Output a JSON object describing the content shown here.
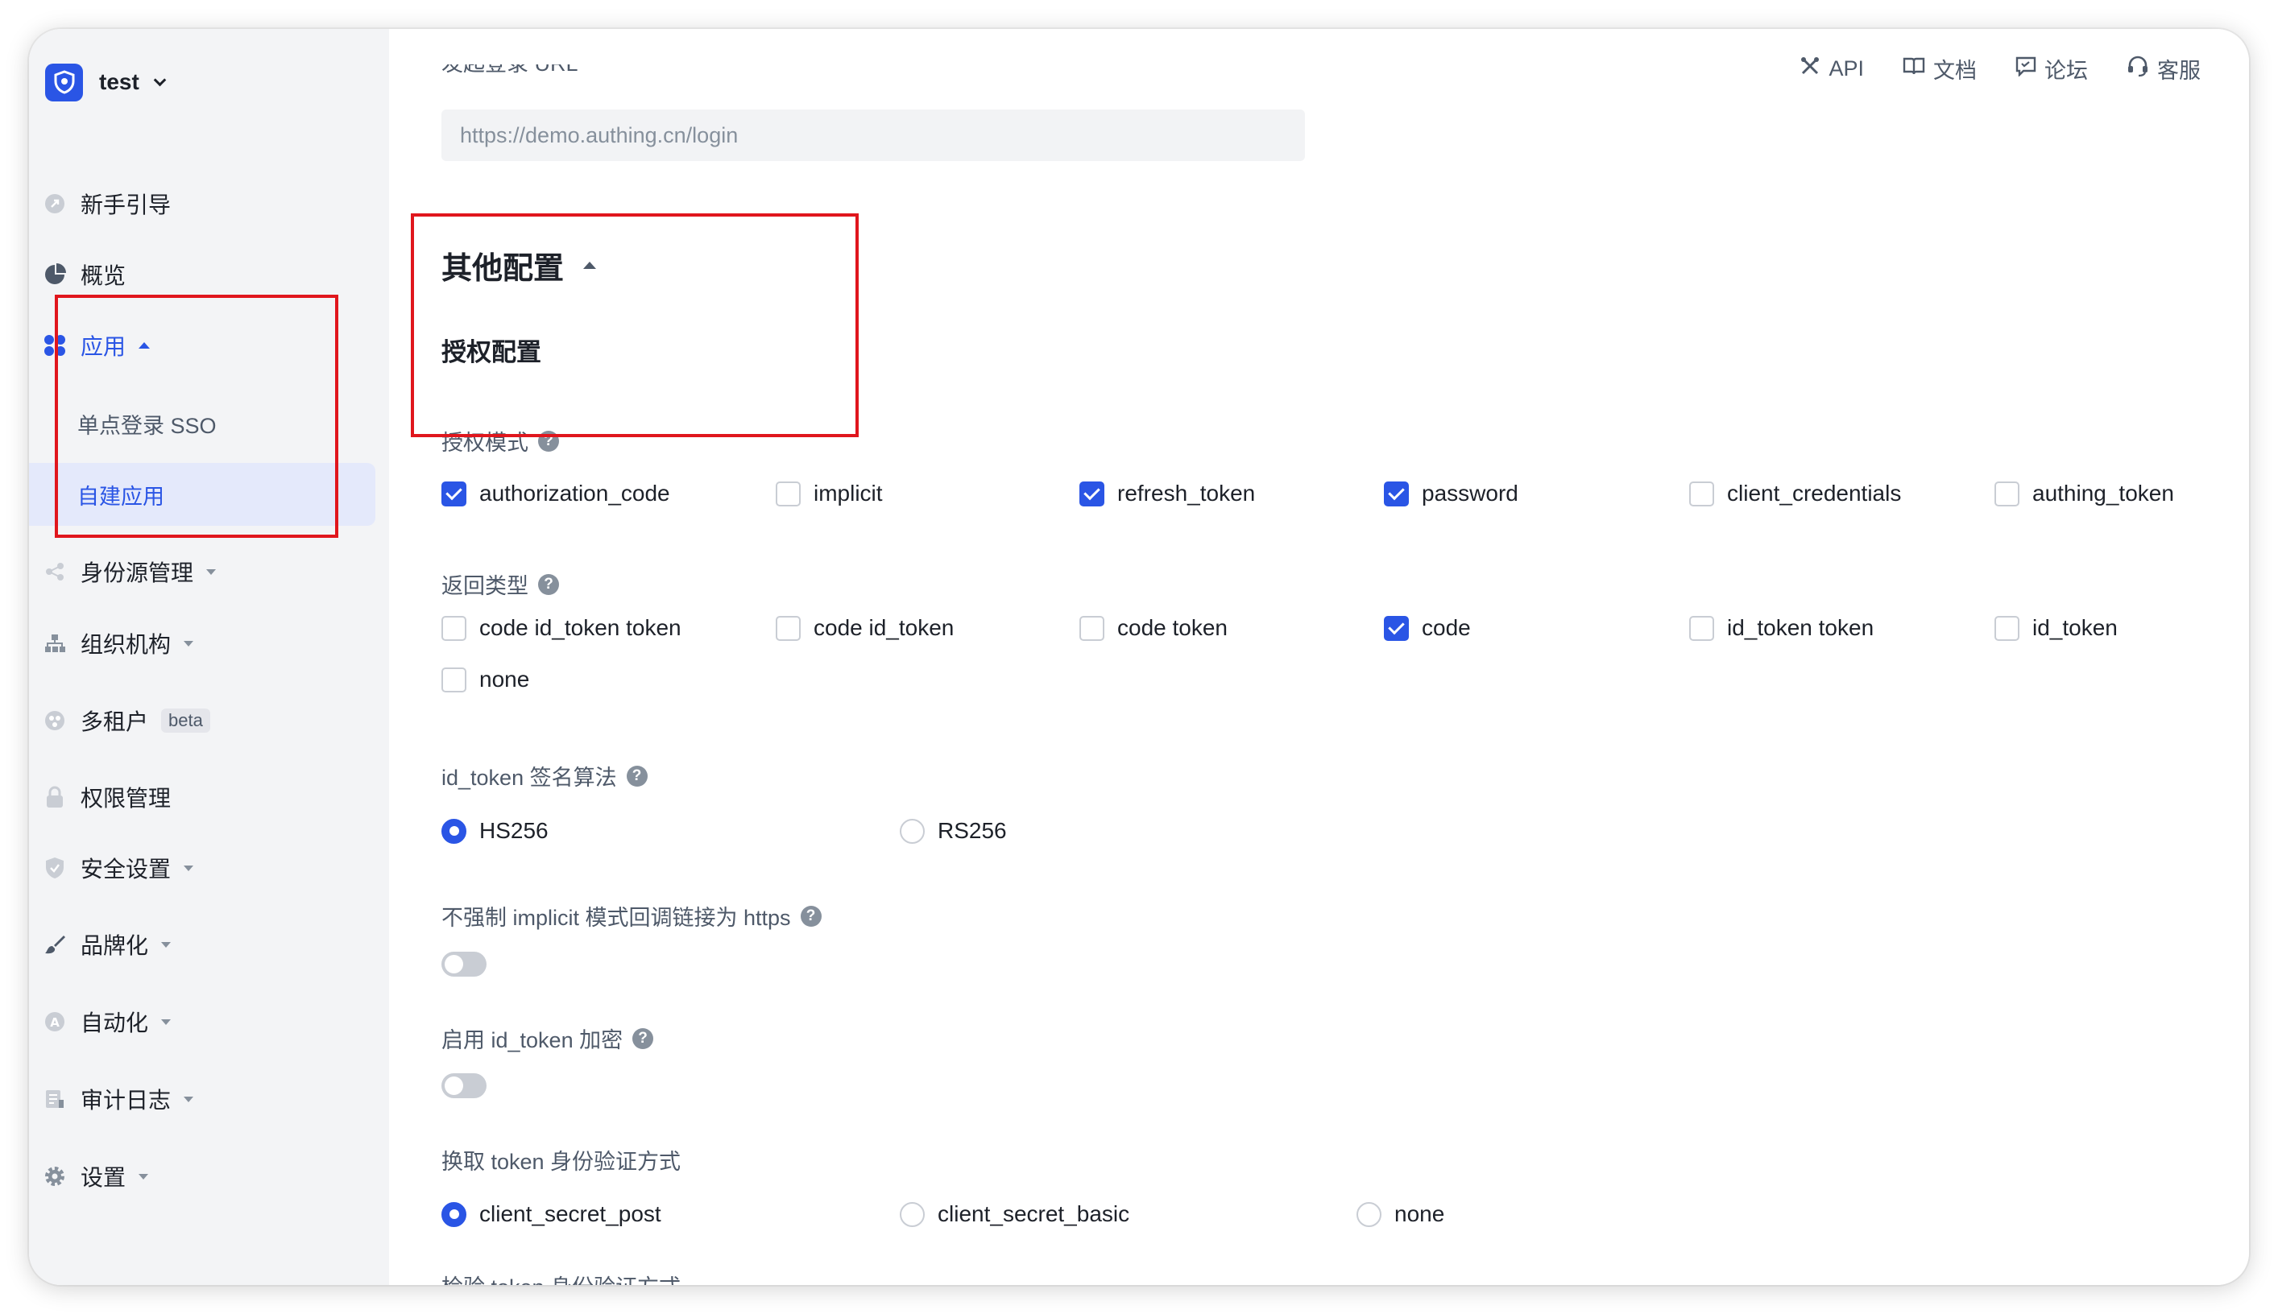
{
  "tenant": {
    "name": "test"
  },
  "colors": {
    "primary": "#2a55e5",
    "sidebar_bg": "#f3f4f6",
    "annotation": "#e0161d"
  },
  "sidebar": {
    "items": [
      {
        "label": "新手引导",
        "icon": "rocket-icon"
      },
      {
        "label": "概览",
        "icon": "pie-chart-icon"
      },
      {
        "label": "应用",
        "icon": "apps-icon",
        "active": true,
        "expanded": true
      },
      {
        "label": "身份源管理",
        "icon": "share-icon"
      },
      {
        "label": "组织机构",
        "icon": "org-tree-icon"
      },
      {
        "label": "多租户",
        "icon": "tenants-icon",
        "badge": "beta"
      },
      {
        "label": "权限管理",
        "icon": "lock-icon"
      },
      {
        "label": "安全设置",
        "icon": "shield-icon"
      },
      {
        "label": "品牌化",
        "icon": "brush-icon"
      },
      {
        "label": "自动化",
        "icon": "automation-icon"
      },
      {
        "label": "审计日志",
        "icon": "log-icon"
      },
      {
        "label": "设置",
        "icon": "gear-icon"
      }
    ],
    "sub_items": [
      {
        "label": "单点登录 SSO"
      },
      {
        "label": "自建应用",
        "selected": true
      }
    ]
  },
  "topbar": {
    "links": [
      {
        "label": "API",
        "icon": "api-tools-icon"
      },
      {
        "label": "文档",
        "icon": "book-icon"
      },
      {
        "label": "论坛",
        "icon": "forum-icon"
      },
      {
        "label": "客服",
        "icon": "headset-icon"
      }
    ]
  },
  "main": {
    "login_url_label": "发起登录 URL",
    "login_url_value": "https://demo.authing.cn/login",
    "section_title": "其他配置",
    "auth_config_title": "授权配置",
    "grant_types": {
      "label": "授权模式",
      "options": [
        {
          "label": "authorization_code",
          "checked": true
        },
        {
          "label": "implicit",
          "checked": false
        },
        {
          "label": "refresh_token",
          "checked": true
        },
        {
          "label": "password",
          "checked": true
        },
        {
          "label": "client_credentials",
          "checked": false
        },
        {
          "label": "authing_token",
          "checked": false
        }
      ]
    },
    "response_types": {
      "label": "返回类型",
      "options": [
        {
          "label": "code id_token token",
          "checked": false
        },
        {
          "label": "code id_token",
          "checked": false
        },
        {
          "label": "code token",
          "checked": false
        },
        {
          "label": "code",
          "checked": true
        },
        {
          "label": "id_token token",
          "checked": false
        },
        {
          "label": "id_token",
          "checked": false
        },
        {
          "label": "none",
          "checked": false
        }
      ]
    },
    "id_token_alg": {
      "label": "id_token 签名算法",
      "options": [
        {
          "label": "HS256",
          "checked": true
        },
        {
          "label": "RS256",
          "checked": false
        }
      ]
    },
    "implicit_https": {
      "label": "不强制 implicit 模式回调链接为 https",
      "enabled": false
    },
    "id_token_encrypt": {
      "label": "启用 id_token 加密",
      "enabled": false
    },
    "token_auth_method": {
      "label": "换取 token 身份验证方式",
      "options": [
        {
          "label": "client_secret_post",
          "checked": true
        },
        {
          "label": "client_secret_basic",
          "checked": false
        },
        {
          "label": "none",
          "checked": false
        }
      ]
    },
    "introspection_auth_method": {
      "label": "检验 token 身份验证方式"
    }
  }
}
